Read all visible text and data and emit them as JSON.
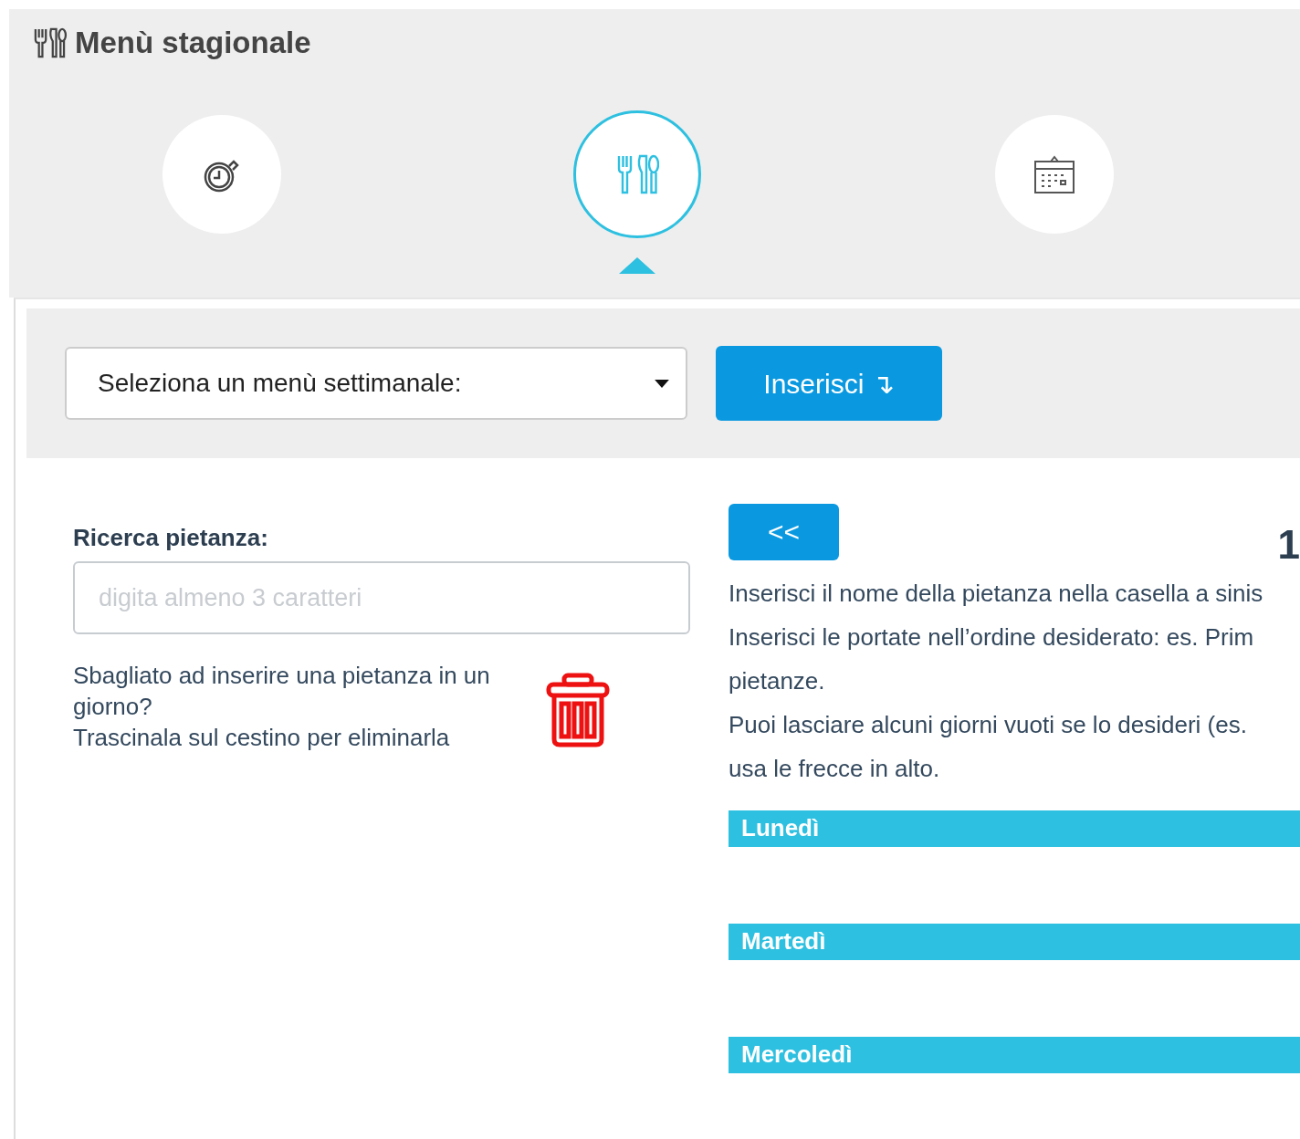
{
  "header": {
    "title": "Menù stagionale"
  },
  "steps": [
    {
      "kind": "timer",
      "selected": false
    },
    {
      "kind": "cutlery",
      "selected": true
    },
    {
      "kind": "calendar",
      "selected": false
    }
  ],
  "toolbar": {
    "select_value": "Seleziona un menù settimanale:",
    "insert_button": "Inserisci ↴"
  },
  "search": {
    "label": "Ricerca pietanza:",
    "placeholder": "digita almeno 3 caratteri"
  },
  "trash_hint": [
    "Sbagliato ad inserire una pietanza in un giorno?",
    "Trascinala sul cestino per eliminarla"
  ],
  "nav": {
    "prev_button": "<<",
    "week": "1"
  },
  "instructions": [
    "Inserisci il nome della pietanza nella casella a sinis",
    "Inserisci le portate nell’ordine desiderato: es. Prim",
    "pietanze.",
    "Puoi lasciare alcuni giorni vuoti se lo desideri (es.",
    "usa le frecce in alto."
  ],
  "days": [
    "Lunedì",
    "Martedì",
    "Mercoledì"
  ]
}
